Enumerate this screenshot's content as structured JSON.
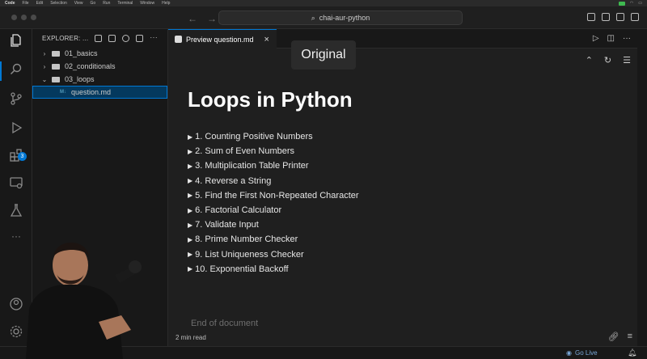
{
  "menubar": {
    "items": [
      "Code",
      "File",
      "Edit",
      "Selection",
      "View",
      "Go",
      "Run",
      "Terminal",
      "Window",
      "Help"
    ]
  },
  "titlebar": {
    "search_text": "chai-aur-python"
  },
  "activity": {
    "extensions_badge": "3"
  },
  "sidebar": {
    "header": "EXPLORER: ...",
    "tree": [
      {
        "label": "01_basics",
        "type": "folder",
        "expanded": false
      },
      {
        "label": "02_conditionals",
        "type": "folder",
        "expanded": false
      },
      {
        "label": "03_loops",
        "type": "folder",
        "expanded": true
      },
      {
        "label": "question.md",
        "type": "file",
        "selected": true
      }
    ]
  },
  "tab": {
    "label": "Preview question.md",
    "close": "×"
  },
  "overlay": {
    "original_label": "Original"
  },
  "document": {
    "title": "Loops in Python",
    "questions": [
      "1. Counting Positive Numbers",
      "2. Sum of Even Numbers",
      "3. Multiplication Table Printer",
      "4. Reverse a String",
      "5. Find the First Non-Repeated Character",
      "6. Factorial Calculator",
      "7. Validate Input",
      "8. Prime Number Checker",
      "9. List Uniqueness Checker",
      "10. Exponential Backoff"
    ],
    "end_text": "End of document",
    "read_time": "2 min read"
  },
  "statusbar": {
    "go_live": "Go Live"
  },
  "colors": {
    "accent": "#0078d4",
    "editor_bg": "#1f1f1f",
    "sidebar_bg": "#181818"
  }
}
